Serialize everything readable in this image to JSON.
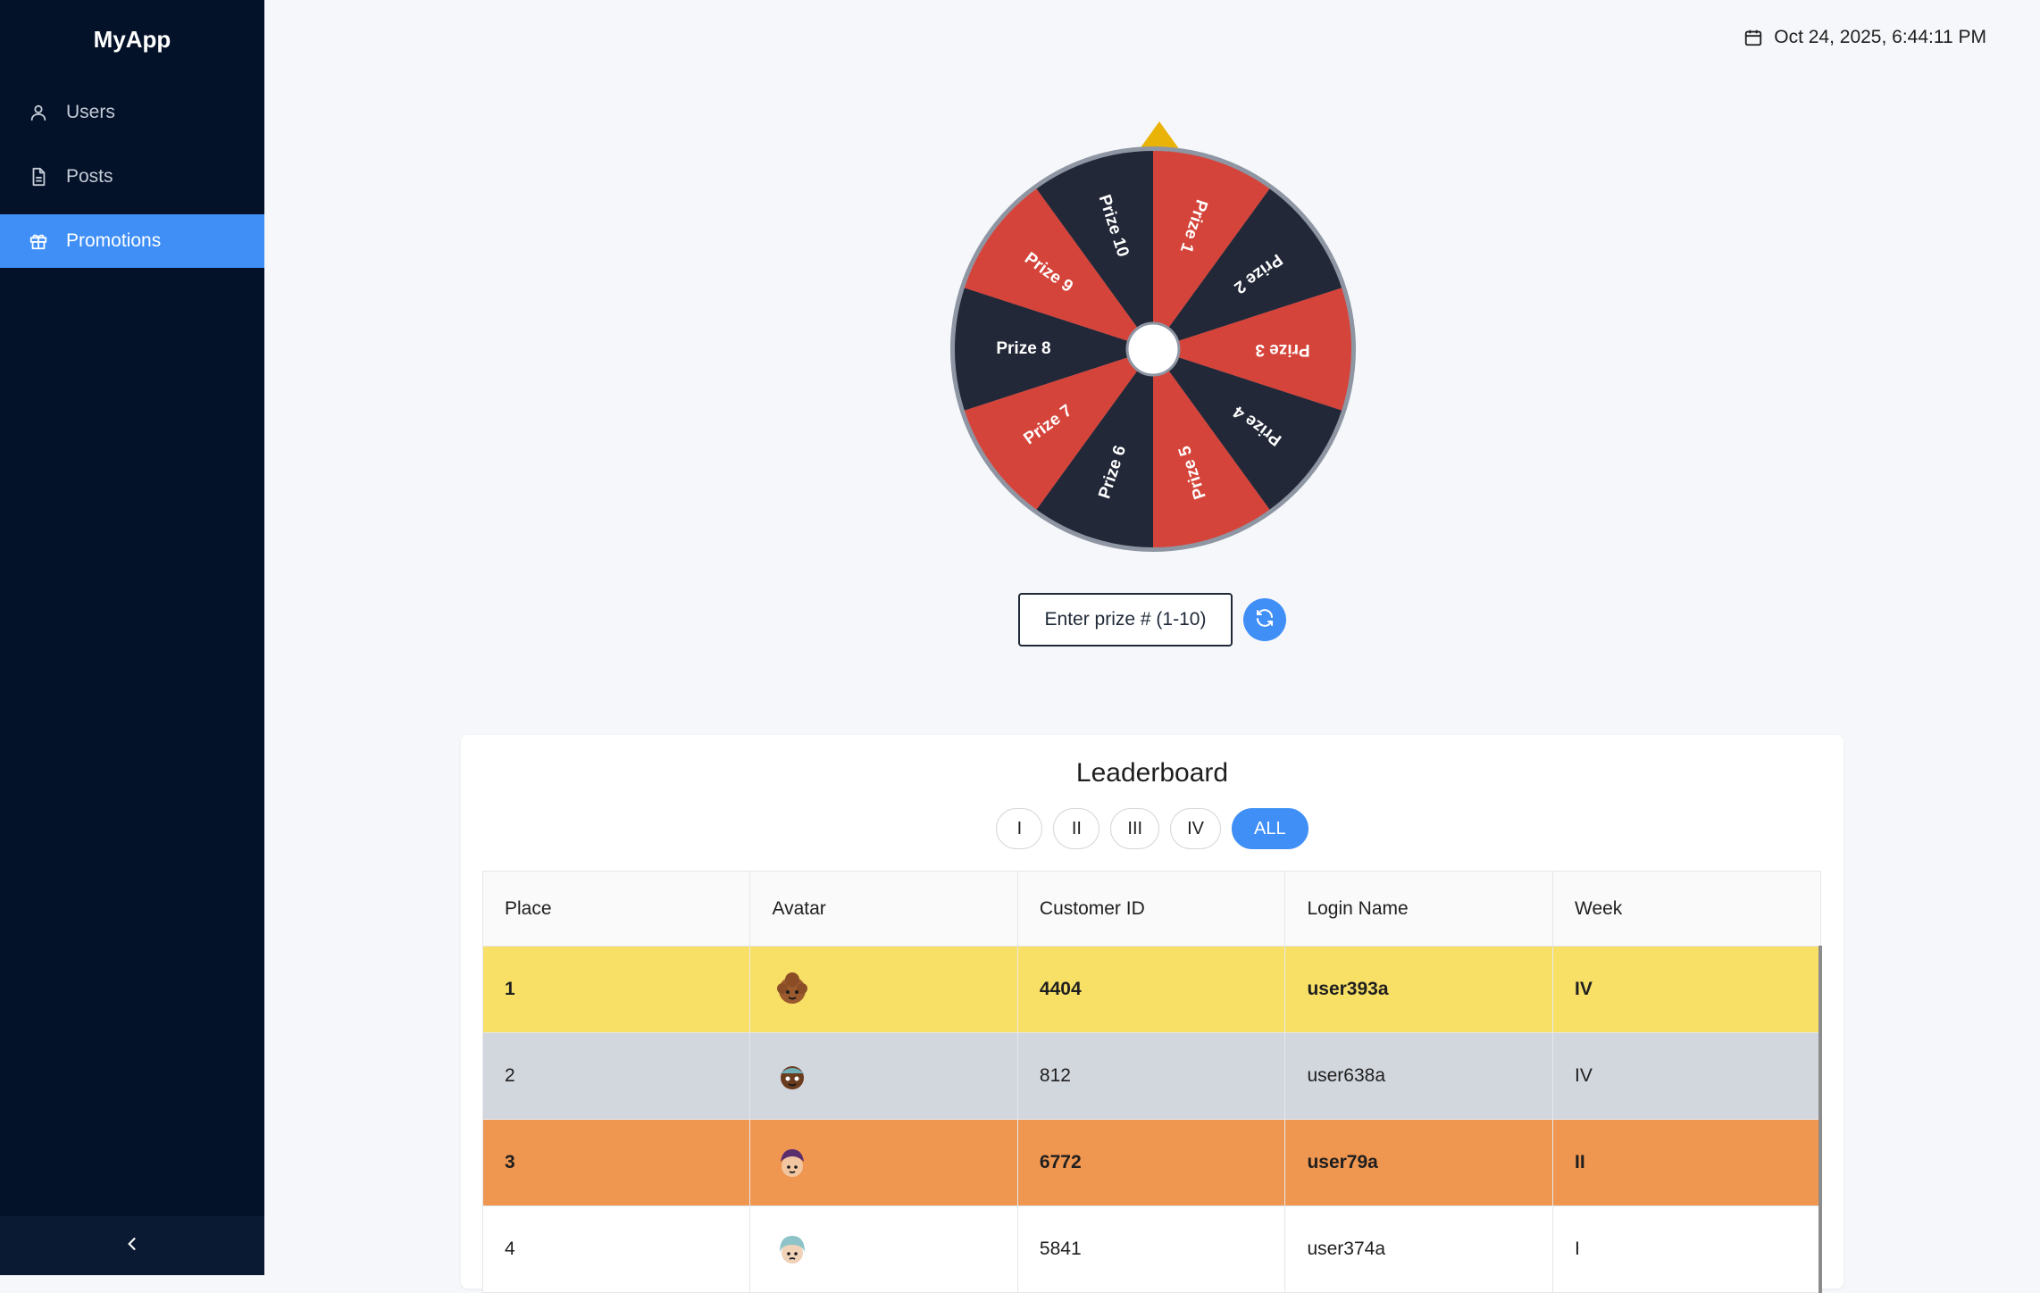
{
  "app": {
    "name": "MyApp"
  },
  "sidebar": {
    "items": [
      {
        "label": "Users",
        "icon": "user-icon",
        "active": false
      },
      {
        "label": "Posts",
        "icon": "document-icon",
        "active": false
      },
      {
        "label": "Promotions",
        "icon": "gift-icon",
        "active": true
      }
    ],
    "collapse_icon": "chevron-left-icon"
  },
  "header": {
    "datetime": "Oct 24, 2025, 6:44:11 PM",
    "icon": "calendar-icon"
  },
  "wheel": {
    "prizes": [
      "Prize 1",
      "Prize 2",
      "Prize 3",
      "Prize 4",
      "Prize 5",
      "Prize 6",
      "Prize 7",
      "Prize 8",
      "Prize 9",
      "Prize 10"
    ],
    "colors": {
      "red": "#d5443a",
      "dark": "#222838",
      "rim": "#8f96a3",
      "pointer": "#eab308"
    },
    "input_placeholder": "Enter prize # (1-10)",
    "spin_icon": "refresh-icon"
  },
  "leaderboard": {
    "title": "Leaderboard",
    "filters": [
      "I",
      "II",
      "III",
      "IV",
      "ALL"
    ],
    "active_filter": "ALL",
    "columns": [
      "Place",
      "Avatar",
      "Customer ID",
      "Login Name",
      "Week"
    ],
    "rows": [
      {
        "place": "1",
        "avatar": "avatar-icon",
        "customer_id": "4404",
        "login": "user393a",
        "week": "IV"
      },
      {
        "place": "2",
        "avatar": "avatar-icon",
        "customer_id": "812",
        "login": "user638a",
        "week": "IV"
      },
      {
        "place": "3",
        "avatar": "avatar-icon",
        "customer_id": "6772",
        "login": "user79a",
        "week": "II"
      },
      {
        "place": "4",
        "avatar": "avatar-icon",
        "customer_id": "5841",
        "login": "user374a",
        "week": "I"
      }
    ]
  }
}
